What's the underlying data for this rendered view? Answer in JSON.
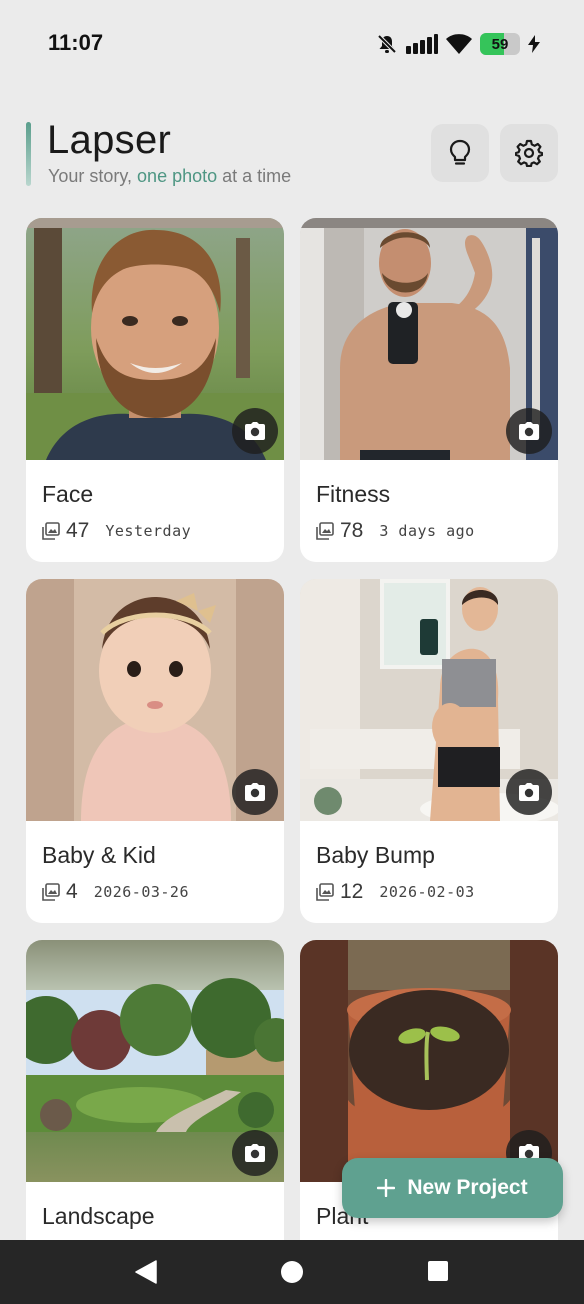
{
  "status_bar": {
    "time": "11:07",
    "battery_level": "59",
    "icons": [
      "mute-icon",
      "signal-icon",
      "wifi-icon",
      "battery-icon",
      "charging-icon"
    ]
  },
  "header": {
    "title": "Lapser",
    "tagline_before": "Your story, ",
    "tagline_accent": "one photo",
    "tagline_after": " at a time",
    "accent_color": "#4e9683",
    "tips_icon": "lightbulb-icon",
    "settings_icon": "gear-icon"
  },
  "projects": [
    {
      "name": "Face",
      "count": "47",
      "date": "Yesterday"
    },
    {
      "name": "Fitness",
      "count": "78",
      "date": "3 days ago"
    },
    {
      "name": "Baby & Kid",
      "count": "4",
      "date": "2026-03-26"
    },
    {
      "name": "Baby Bump",
      "count": "12",
      "date": "2026-02-03"
    },
    {
      "name": "Landscape"
    },
    {
      "name": "Plant"
    }
  ],
  "fab": {
    "label": "New Project",
    "icon": "plus-icon",
    "color": "#5fa190"
  },
  "nav_bar": {
    "icons": [
      "back-icon",
      "home-icon",
      "recents-icon"
    ]
  }
}
